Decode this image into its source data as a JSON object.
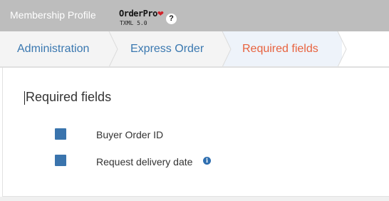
{
  "header": {
    "app_title": "Membership Profile",
    "logo_name": "OrderPro",
    "logo_heart": "❤",
    "logo_sub": "TXML 5.0",
    "help_glyph": "?"
  },
  "breadcrumbs": [
    {
      "label": "Administration",
      "active": false
    },
    {
      "label": "Express Order",
      "active": false
    },
    {
      "label": "Required fields",
      "active": true
    }
  ],
  "colors": {
    "topbar": "#bdbdbd",
    "link": "#3a78b0",
    "active_crumb": "#e8623e",
    "checkbox": "#3a74ad"
  },
  "main": {
    "title": "Required fields",
    "fields": [
      {
        "label": "Buyer Order ID",
        "checked": true,
        "info": false
      },
      {
        "label": "Request delivery date",
        "checked": true,
        "info": true,
        "info_glyph": "i"
      }
    ]
  }
}
